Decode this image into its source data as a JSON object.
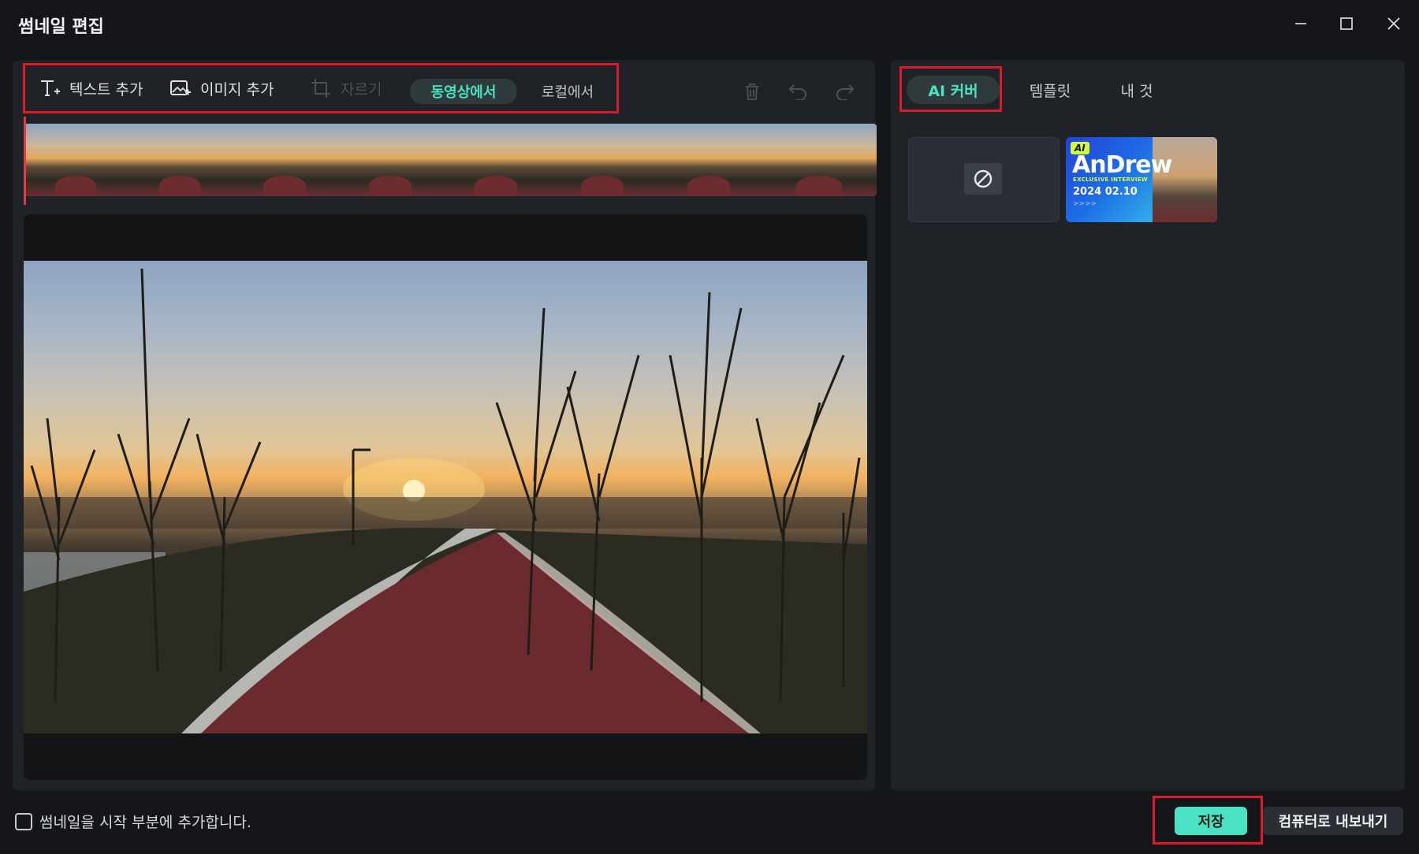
{
  "window": {
    "title": "썸네일 편집"
  },
  "toolbar": {
    "add_text": "텍스트 추가",
    "add_image": "이미지 추가",
    "crop": "자르기",
    "from_video": "동영상에서",
    "from_local": "로컬에서"
  },
  "right_tabs": {
    "ai_cover": "AI 커버",
    "template": "템플릿",
    "mine": "내 것"
  },
  "ai_cover_card": {
    "badge": "AI",
    "name": "AnDrew",
    "subtitle": "EXCLUSIVE INTERVIEW",
    "date": "2024 02.10",
    "chevrons": ">>>>"
  },
  "footer": {
    "checkbox_label": "썸네일을 시작 부분에 추가합니다.",
    "checkbox_checked": false,
    "save": "저장",
    "export": "컴퓨터로 내보내기"
  },
  "colors": {
    "accent": "#49e3c3",
    "highlight_red": "#e0182d",
    "background": "#141619",
    "panel": "#1f2328"
  }
}
